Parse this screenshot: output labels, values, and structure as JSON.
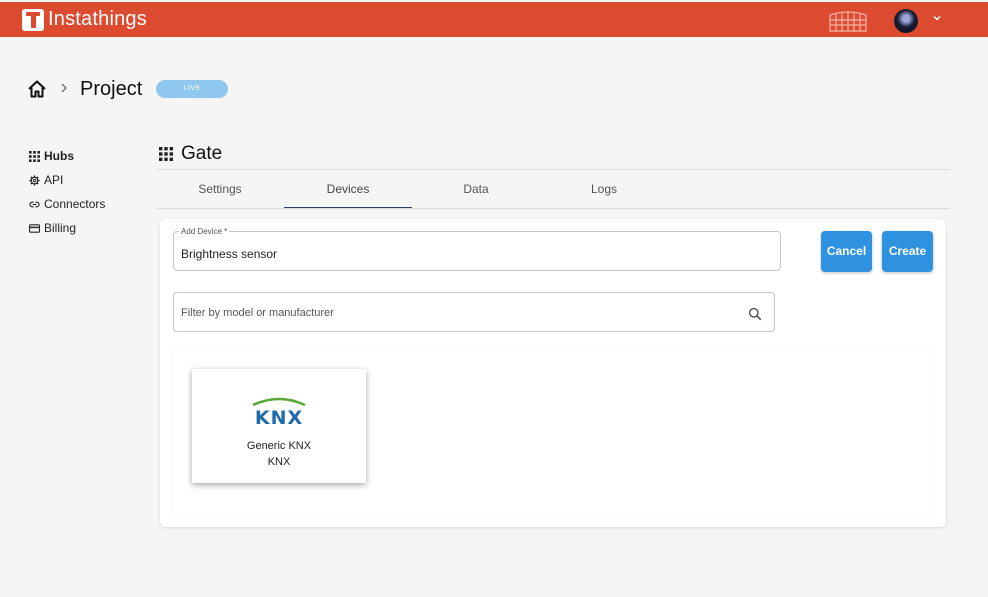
{
  "app": {
    "name": "Instathings"
  },
  "breadcrumb": {
    "current": "Project",
    "status_badge": "LIVE"
  },
  "sidebar": {
    "items": [
      {
        "label": "Hubs",
        "icon": "grid-icon",
        "active": true
      },
      {
        "label": "API",
        "icon": "gear-icon",
        "active": false
      },
      {
        "label": "Connectors",
        "icon": "link-icon",
        "active": false
      },
      {
        "label": "Billing",
        "icon": "card-icon",
        "active": false
      }
    ]
  },
  "hub": {
    "title": "Gate",
    "icon": "grid-icon"
  },
  "tabs": [
    {
      "label": "Settings",
      "active": false
    },
    {
      "label": "Devices",
      "active": true
    },
    {
      "label": "Data",
      "active": false
    },
    {
      "label": "Logs",
      "active": false
    }
  ],
  "form": {
    "add_device_label": "Add Device *",
    "add_device_value": "Brightness sensor",
    "cancel_label": "Cancel",
    "create_label": "Create",
    "filter_placeholder": "Filter by model or manufacturer"
  },
  "devices": [
    {
      "name": "Generic KNX",
      "manufacturer": "KNX",
      "logo": "knx-logo"
    }
  ],
  "colors": {
    "topbar": "#dc4a2f",
    "primary_button": "#2f92e0",
    "live_badge": "#8fc7ee",
    "active_tab_underline": "#2c3e67"
  }
}
